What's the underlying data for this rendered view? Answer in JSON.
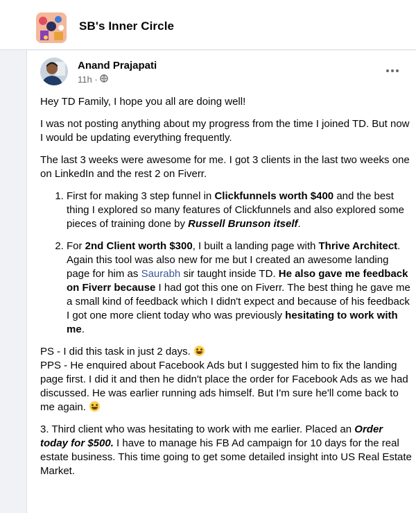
{
  "group": {
    "name": "SB's Inner Circle",
    "thumbnail_icon": "group-cover-thumbnail"
  },
  "post": {
    "author": "Anand Prajapati",
    "time": "11h ·",
    "privacy_icon": "globe-icon",
    "menu_icon": "more-options-icon",
    "greeting": "Hey TD Family, I hope you all are doing well!",
    "intro": "I was not posting anything about my progress from the time I joined TD. But now I would be updating everything frequently.",
    "summary": "The last 3 weeks were awesome for me. I got 3 clients in the last two weeks one on LinkedIn and the rest 2 on Fiverr.",
    "item1": {
      "t1": "First for making 3 step funnel in ",
      "b1": "Clickfunnels worth $400",
      "t2": " and the best thing I explored so many features of Clickfunnels and also explored some pieces of training done by ",
      "bi1": "Russell Brunson itself",
      "t3": "."
    },
    "item2": {
      "t1": "For ",
      "b1": "2nd Client worth $300",
      "t2": ", I built a landing page with ",
      "b2": "Thrive Architect",
      "t3": ". Again this tool was also new for me but I created an awesome landing page for him as ",
      "mention": "Saurabh",
      "t4": " sir taught inside TD. ",
      "b3": "He also gave me feedback on Fiverr because",
      "t5": " I had got this one on Fiverr. The best thing he gave me a small kind of feedback which I didn't expect and because of his feedback I got one more client today who was previously ",
      "b4": "hesitating to work with me",
      "t6": "."
    },
    "ps": "PS - I did this task in just 2 days. ",
    "pps": "PPS - He enquired about Facebook Ads but I suggested him to fix the landing page first. I did it and then he didn't place the order for Facebook Ads as we had discussed. He was earlier running ads himself. But I'm sure he'll come back to me again. ",
    "item3": {
      "t1": "3. Third client who was hesitating to work with me earlier. Placed an ",
      "bi1": "Order today for $500.",
      "t2": " I have to manage his FB Ad campaign for 10 days for the real estate business. This time going to get some detailed insight into US Real Estate Market."
    },
    "colors": {
      "mention": "#385898",
      "meta": "#65676b",
      "text": "#050505"
    }
  }
}
